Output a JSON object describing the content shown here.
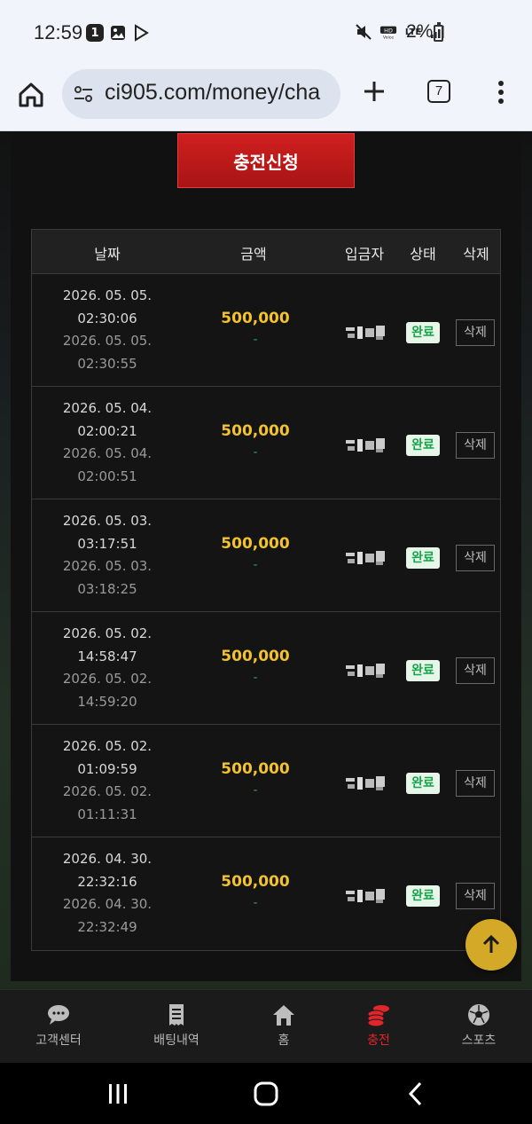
{
  "status_bar": {
    "time": "12:59",
    "notification_count": "1",
    "network": "LTE",
    "battery": "2%"
  },
  "browser": {
    "url": "ci905.com/money/cha",
    "tab_count": "7"
  },
  "main": {
    "charge_button": "충전신청",
    "table": {
      "headers": {
        "date": "날짜",
        "amount": "금액",
        "depositor": "입금자",
        "status": "상태",
        "delete": "삭제"
      },
      "rows": [
        {
          "date1": "2026. 05. 05.",
          "time1": "02:30:06",
          "date2": "2026. 05. 05.",
          "time2": "02:30:55",
          "amount": "500,000",
          "dash": "-",
          "status": "완료",
          "delete": "삭제"
        },
        {
          "date1": "2026. 05. 04.",
          "time1": "02:00:21",
          "date2": "2026. 05. 04.",
          "time2": "02:00:51",
          "amount": "500,000",
          "dash": "-",
          "status": "완료",
          "delete": "삭제"
        },
        {
          "date1": "2026. 05. 03.",
          "time1": "03:17:51",
          "date2": "2026. 05. 03.",
          "time2": "03:18:25",
          "amount": "500,000",
          "dash": "-",
          "status": "완료",
          "delete": "삭제"
        },
        {
          "date1": "2026. 05. 02.",
          "time1": "14:58:47",
          "date2": "2026. 05. 02.",
          "time2": "14:59:20",
          "amount": "500,000",
          "dash": "-",
          "status": "완료",
          "delete": "삭제"
        },
        {
          "date1": "2026. 05. 02.",
          "time1": "01:09:59",
          "date2": "2026. 05. 02.",
          "time2": "01:11:31",
          "amount": "500,000",
          "dash": "-",
          "status": "완료",
          "delete": "삭제"
        },
        {
          "date1": "2026. 04. 30.",
          "time1": "22:32:16",
          "date2": "2026. 04. 30.",
          "time2": "22:32:49",
          "amount": "500,000",
          "dash": "-",
          "status": "완료",
          "delete": "삭제"
        }
      ]
    }
  },
  "bottom_nav": [
    {
      "label": "고객센터",
      "icon": "chat-icon"
    },
    {
      "label": "배팅내역",
      "icon": "receipt-icon"
    },
    {
      "label": "홈",
      "icon": "home-icon"
    },
    {
      "label": "충전",
      "icon": "coins-icon",
      "active": true
    },
    {
      "label": "스포츠",
      "icon": "soccer-ball-icon"
    }
  ],
  "colors": {
    "accent": "#e0262b",
    "amount": "#f2c230",
    "status_ok": "#16a34a",
    "scroll_top": "#d4a928"
  }
}
